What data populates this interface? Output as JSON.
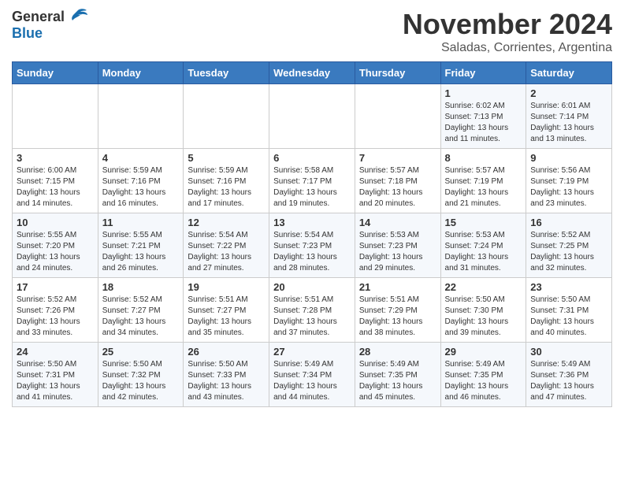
{
  "header": {
    "logo_general": "General",
    "logo_blue": "Blue",
    "title": "November 2024",
    "subtitle": "Saladas, Corrientes, Argentina"
  },
  "weekdays": [
    "Sunday",
    "Monday",
    "Tuesday",
    "Wednesday",
    "Thursday",
    "Friday",
    "Saturday"
  ],
  "weeks": [
    {
      "days": [
        {
          "num": "",
          "info": ""
        },
        {
          "num": "",
          "info": ""
        },
        {
          "num": "",
          "info": ""
        },
        {
          "num": "",
          "info": ""
        },
        {
          "num": "",
          "info": ""
        },
        {
          "num": "1",
          "info": "Sunrise: 6:02 AM\nSunset: 7:13 PM\nDaylight: 13 hours and 11 minutes."
        },
        {
          "num": "2",
          "info": "Sunrise: 6:01 AM\nSunset: 7:14 PM\nDaylight: 13 hours and 13 minutes."
        }
      ]
    },
    {
      "days": [
        {
          "num": "3",
          "info": "Sunrise: 6:00 AM\nSunset: 7:15 PM\nDaylight: 13 hours and 14 minutes."
        },
        {
          "num": "4",
          "info": "Sunrise: 5:59 AM\nSunset: 7:16 PM\nDaylight: 13 hours and 16 minutes."
        },
        {
          "num": "5",
          "info": "Sunrise: 5:59 AM\nSunset: 7:16 PM\nDaylight: 13 hours and 17 minutes."
        },
        {
          "num": "6",
          "info": "Sunrise: 5:58 AM\nSunset: 7:17 PM\nDaylight: 13 hours and 19 minutes."
        },
        {
          "num": "7",
          "info": "Sunrise: 5:57 AM\nSunset: 7:18 PM\nDaylight: 13 hours and 20 minutes."
        },
        {
          "num": "8",
          "info": "Sunrise: 5:57 AM\nSunset: 7:19 PM\nDaylight: 13 hours and 21 minutes."
        },
        {
          "num": "9",
          "info": "Sunrise: 5:56 AM\nSunset: 7:19 PM\nDaylight: 13 hours and 23 minutes."
        }
      ]
    },
    {
      "days": [
        {
          "num": "10",
          "info": "Sunrise: 5:55 AM\nSunset: 7:20 PM\nDaylight: 13 hours and 24 minutes."
        },
        {
          "num": "11",
          "info": "Sunrise: 5:55 AM\nSunset: 7:21 PM\nDaylight: 13 hours and 26 minutes."
        },
        {
          "num": "12",
          "info": "Sunrise: 5:54 AM\nSunset: 7:22 PM\nDaylight: 13 hours and 27 minutes."
        },
        {
          "num": "13",
          "info": "Sunrise: 5:54 AM\nSunset: 7:23 PM\nDaylight: 13 hours and 28 minutes."
        },
        {
          "num": "14",
          "info": "Sunrise: 5:53 AM\nSunset: 7:23 PM\nDaylight: 13 hours and 29 minutes."
        },
        {
          "num": "15",
          "info": "Sunrise: 5:53 AM\nSunset: 7:24 PM\nDaylight: 13 hours and 31 minutes."
        },
        {
          "num": "16",
          "info": "Sunrise: 5:52 AM\nSunset: 7:25 PM\nDaylight: 13 hours and 32 minutes."
        }
      ]
    },
    {
      "days": [
        {
          "num": "17",
          "info": "Sunrise: 5:52 AM\nSunset: 7:26 PM\nDaylight: 13 hours and 33 minutes."
        },
        {
          "num": "18",
          "info": "Sunrise: 5:52 AM\nSunset: 7:27 PM\nDaylight: 13 hours and 34 minutes."
        },
        {
          "num": "19",
          "info": "Sunrise: 5:51 AM\nSunset: 7:27 PM\nDaylight: 13 hours and 35 minutes."
        },
        {
          "num": "20",
          "info": "Sunrise: 5:51 AM\nSunset: 7:28 PM\nDaylight: 13 hours and 37 minutes."
        },
        {
          "num": "21",
          "info": "Sunrise: 5:51 AM\nSunset: 7:29 PM\nDaylight: 13 hours and 38 minutes."
        },
        {
          "num": "22",
          "info": "Sunrise: 5:50 AM\nSunset: 7:30 PM\nDaylight: 13 hours and 39 minutes."
        },
        {
          "num": "23",
          "info": "Sunrise: 5:50 AM\nSunset: 7:31 PM\nDaylight: 13 hours and 40 minutes."
        }
      ]
    },
    {
      "days": [
        {
          "num": "24",
          "info": "Sunrise: 5:50 AM\nSunset: 7:31 PM\nDaylight: 13 hours and 41 minutes."
        },
        {
          "num": "25",
          "info": "Sunrise: 5:50 AM\nSunset: 7:32 PM\nDaylight: 13 hours and 42 minutes."
        },
        {
          "num": "26",
          "info": "Sunrise: 5:50 AM\nSunset: 7:33 PM\nDaylight: 13 hours and 43 minutes."
        },
        {
          "num": "27",
          "info": "Sunrise: 5:49 AM\nSunset: 7:34 PM\nDaylight: 13 hours and 44 minutes."
        },
        {
          "num": "28",
          "info": "Sunrise: 5:49 AM\nSunset: 7:35 PM\nDaylight: 13 hours and 45 minutes."
        },
        {
          "num": "29",
          "info": "Sunrise: 5:49 AM\nSunset: 7:35 PM\nDaylight: 13 hours and 46 minutes."
        },
        {
          "num": "30",
          "info": "Sunrise: 5:49 AM\nSunset: 7:36 PM\nDaylight: 13 hours and 47 minutes."
        }
      ]
    }
  ]
}
